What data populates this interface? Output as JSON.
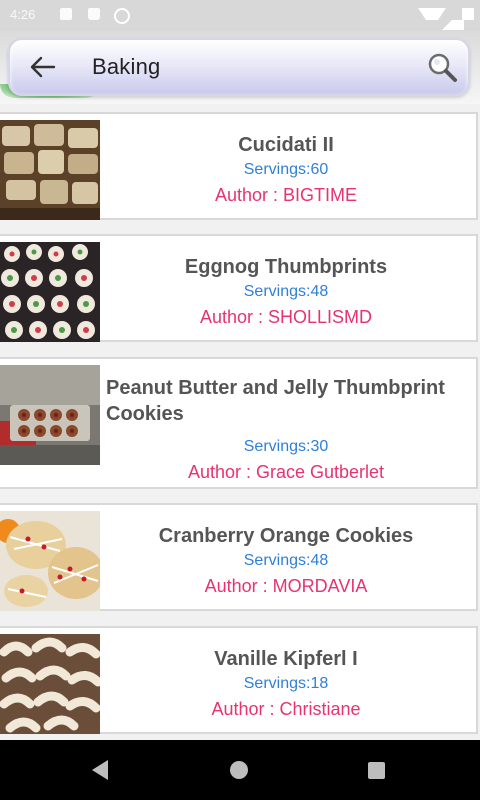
{
  "status": {
    "time": "4:26"
  },
  "search": {
    "query": "Baking"
  },
  "recipes": [
    {
      "title": "Cucidati II",
      "servings": "Servings:60",
      "author": "Author : BIGTIME"
    },
    {
      "title": "Eggnog Thumbprints",
      "servings": "Servings:48",
      "author": "Author : SHOLLISMD"
    },
    {
      "title": "Peanut Butter and Jelly Thumbprint Cookies",
      "servings": "Servings:30",
      "author": "Author : Grace Gutberlet"
    },
    {
      "title": "Cranberry Orange Cookies",
      "servings": "Servings:48",
      "author": "Author : MORDAVIA"
    },
    {
      "title": "Vanille Kipferl I",
      "servings": "Servings:18",
      "author": "Author : Christiane"
    }
  ],
  "colors": {
    "servings": "#2f7fd8",
    "author": "#e8336e",
    "title": "#555555"
  }
}
